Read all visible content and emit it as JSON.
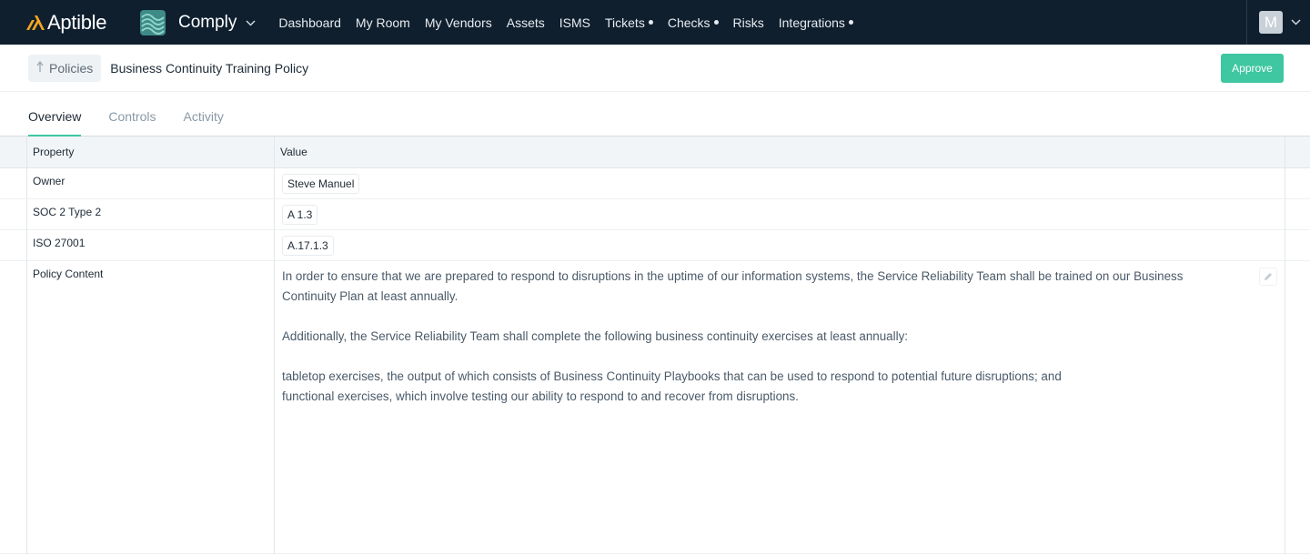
{
  "topnav": {
    "brand": "Aptible",
    "product": "Comply",
    "links": [
      {
        "label": "Dashboard",
        "dot": false
      },
      {
        "label": "My Room",
        "dot": false
      },
      {
        "label": "My Vendors",
        "dot": false
      },
      {
        "label": "Assets",
        "dot": false
      },
      {
        "label": "ISMS",
        "dot": false
      },
      {
        "label": "Tickets",
        "dot": true
      },
      {
        "label": "Checks",
        "dot": true
      },
      {
        "label": "Risks",
        "dot": false
      },
      {
        "label": "Integrations",
        "dot": true
      }
    ],
    "avatar_initial": "M"
  },
  "subheader": {
    "back_label": "Policies",
    "title": "Business Continuity Training Policy",
    "approve_label": "Approve"
  },
  "tabs": [
    {
      "label": "Overview",
      "active": true
    },
    {
      "label": "Controls",
      "active": false
    },
    {
      "label": "Activity",
      "active": false
    }
  ],
  "grid": {
    "headers": {
      "property": "Property",
      "value": "Value"
    },
    "rows": [
      {
        "property": "Owner",
        "value": "Steve Manuel"
      },
      {
        "property": "SOC 2 Type 2",
        "value": "A 1.3"
      },
      {
        "property": "ISO 27001",
        "value": "A.17.1.3"
      }
    ],
    "content": {
      "property": "Policy Content",
      "paragraphs": [
        "In order to ensure that we are prepared to respond to disruptions in the uptime of our information systems, the Service Reliability Team shall be trained on our Business Continuity Plan at least annually.",
        "Additionally, the Service Reliability Team shall complete the following business continuity exercises at least annually:"
      ],
      "list_items": [
        "tabletop exercises, the output of which consists of Business Continuity Playbooks that can be used to respond to potential future disruptions; and",
        "functional exercises, which involve testing our ability to respond to and recover from disruptions."
      ]
    }
  },
  "colors": {
    "nav_bg": "#0f1f2e",
    "accent": "#3ec7a1",
    "brand_yellow": "#f5a623",
    "product_teal": "#3d8a86"
  },
  "icons": [
    "aptible-logo-icon",
    "comply-logo-icon",
    "chevron-down-icon",
    "back-arrow-icon",
    "pencil-icon"
  ]
}
